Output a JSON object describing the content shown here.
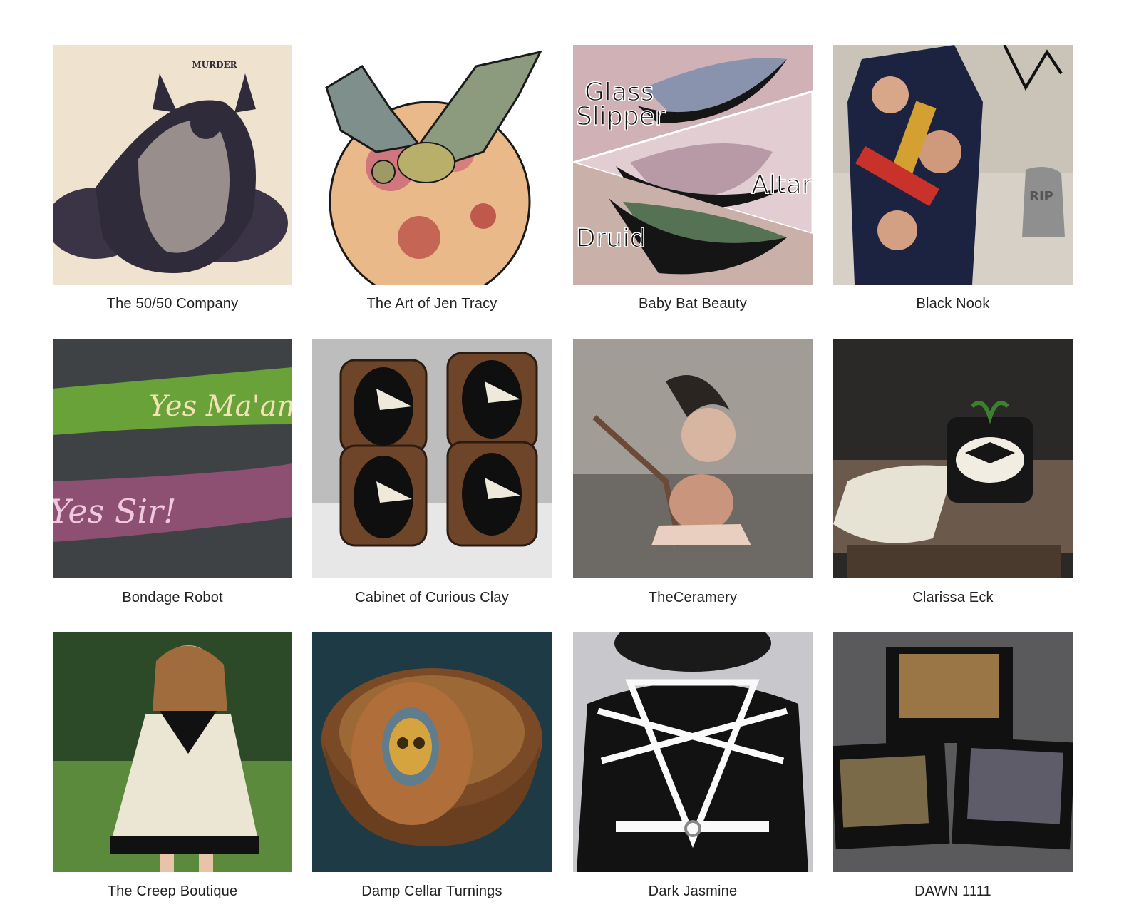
{
  "vendors": [
    {
      "name": "The 50/50 Company",
      "image": "murder-cat-print",
      "image_text": "MURDER"
    },
    {
      "name": "The Art of Jen Tracy",
      "image": "watercolor-bat-moon"
    },
    {
      "name": "Baby Bat Beauty",
      "image": "glitter-eyeshadow",
      "image_labels": [
        "Glass",
        "Slipper",
        "Altar",
        "Druid"
      ]
    },
    {
      "name": "Black Nook",
      "image": "dracula-coffin-bag",
      "image_text": "RIP"
    },
    {
      "name": "Bondage Robot",
      "image": "leather-paddles",
      "image_labels": [
        "Yes Ma'am",
        "Yes Sir!"
      ]
    },
    {
      "name": "Cabinet of Curious Clay",
      "image": "plague-doctor-mugs"
    },
    {
      "name": "TheCeramery",
      "image": "doll-head-bird-sculpture"
    },
    {
      "name": "Clarissa Eck",
      "image": "moth-planter"
    },
    {
      "name": "The Creep Boutique",
      "image": "halloween-dress-child"
    },
    {
      "name": "Damp Cellar Turnings",
      "image": "skull-wood-bowl"
    },
    {
      "name": "Dark Jasmine",
      "image": "pentagram-harness"
    },
    {
      "name": "DAWN 1111",
      "image": "framed-photo-prints"
    }
  ]
}
